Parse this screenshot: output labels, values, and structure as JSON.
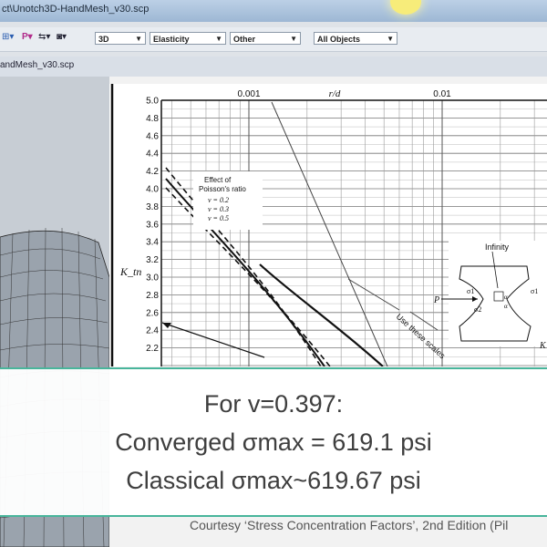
{
  "window": {
    "title": "ct\\Unotch3D-HandMesh_v30.scp",
    "tab_label": "andMesh_v30.scp"
  },
  "toolbar": {
    "dropdowns": [
      {
        "name": "view",
        "value": "3D"
      },
      {
        "name": "physics",
        "value": "Elasticity"
      },
      {
        "name": "analysis",
        "value": "Other"
      },
      {
        "name": "objects",
        "value": "All Objects"
      }
    ],
    "icons": [
      "select-icon",
      "pointer-icon",
      "move-icon",
      "camera-icon"
    ]
  },
  "chart_data": {
    "type": "line",
    "top_axis": {
      "label": "r/d",
      "tick_labels": [
        "0.001",
        "0.01"
      ]
    },
    "ylabel": "K_tn",
    "y_ticks": [
      "2.2",
      "2.4",
      "2.6",
      "2.8",
      "3.0",
      "3.2",
      "3.4",
      "3.6",
      "3.8",
      "4.0",
      "4.2",
      "4.4",
      "4.6",
      "4.8",
      "5.0"
    ],
    "ylim": [
      2.2,
      5.0
    ],
    "legend": {
      "title": "Effect of Poisson's ratio",
      "entries": [
        "ν = 0.2",
        "ν = 0.3",
        "ν = 0.5"
      ]
    },
    "annotations": [
      "Use these scales",
      "Infinity"
    ],
    "inset_labels": [
      "P",
      "σ1",
      "σ2",
      "σ1",
      "α",
      "α",
      "K"
    ],
    "grid": true
  },
  "overlay": {
    "line1": "For v=0.397:",
    "line2": "Converged σmax = 619.1 psi",
    "line3": "Classical σmax~619.67 psi"
  },
  "footer": {
    "courtesy": "Courtesy ‘Stress Concentration Factors’, 2nd Edition (Pil"
  }
}
